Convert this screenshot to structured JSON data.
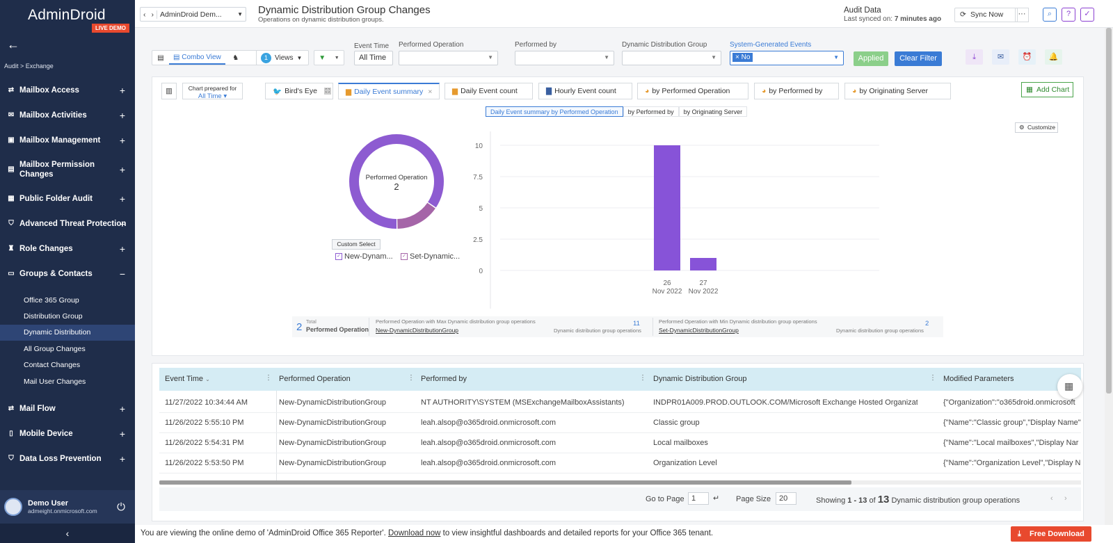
{
  "app": {
    "logo": "AdminDroid",
    "badge": "LIVE DEMO"
  },
  "sidebar": {
    "breadcrumb": "Audit > Exchange",
    "items": [
      {
        "label": "Mailbox Access",
        "toggle": "+"
      },
      {
        "label": "Mailbox Activities",
        "toggle": "+"
      },
      {
        "label": "Mailbox Management",
        "toggle": "+"
      },
      {
        "label": "Mailbox Permission",
        "label2": "Changes",
        "toggle": "+"
      },
      {
        "label": "Public Folder Audit",
        "toggle": "+"
      },
      {
        "label": "Advanced Threat Protection",
        "toggle": "+"
      },
      {
        "label": "Role Changes",
        "toggle": "+"
      },
      {
        "label": "Groups & Contacts",
        "toggle": "−"
      },
      {
        "label": "Mail Flow",
        "toggle": "+"
      },
      {
        "label": "Mobile Device",
        "toggle": "+"
      },
      {
        "label": "Data Loss Prevention",
        "toggle": "+"
      }
    ],
    "subitems": [
      "Office 365 Group",
      "Distribution Group",
      "Dynamic Distribution",
      "All Group Changes",
      "Contact Changes",
      "Mail User Changes"
    ],
    "user": {
      "name": "Demo User",
      "email": "admeight.onmicrosoft.com"
    }
  },
  "header": {
    "nav_select": "AdminDroid Dem...",
    "title": "Dynamic Distribution Group Changes",
    "subtitle": "Operations on dynamic distribution groups.",
    "audit_label": "Audit Data",
    "synced_prefix": "Last synced on:",
    "synced_value": "7 minutes ago",
    "sync_button": "Sync Now",
    "more": "···"
  },
  "filters": {
    "combo_view": "Combo View",
    "views_count": "1",
    "views_label": "Views",
    "event_time_label": "Event Time",
    "event_time_value": "All Time",
    "performed_operation_label": "Performed Operation",
    "performed_by_label": "Performed by",
    "ddg_label": "Dynamic Distribution Group",
    "system_events_label": "System-Generated Events",
    "system_events_value": "× No",
    "applied_button": "Applied",
    "clear_button": "Clear Filter"
  },
  "chart_tabs": {
    "prepared_label": "Chart prepared for",
    "prepared_value": "All Time",
    "tabs": [
      "Bird's Eye",
      "Daily Event summary",
      "Daily Event count",
      "Hourly Event count",
      "by Performed Operation",
      "by Performed by",
      "by Originating Server"
    ],
    "add_chart": "Add Chart",
    "subtabs": [
      "Daily Event summary by Performed Operation",
      "by Performed by",
      "by Originating Server"
    ],
    "customize": "Customize",
    "custom_select": "Custom Select"
  },
  "donut": {
    "center_label": "Performed Operation",
    "center_value": "2",
    "legend": [
      "New-Dynam...",
      "Set-Dynamic..."
    ]
  },
  "chart_data": {
    "type": "bar",
    "categories": [
      "26 Nov 2022",
      "27 Nov 2022"
    ],
    "values": [
      10,
      1
    ],
    "ylim": [
      0,
      10
    ],
    "yticks": [
      "0",
      "2.5",
      "5",
      "7.5",
      "10"
    ],
    "xticks": [
      {
        "d": "26",
        "m": "Nov 2022"
      },
      {
        "d": "27",
        "m": "Nov 2022"
      }
    ],
    "pie": {
      "slices": [
        11,
        2
      ],
      "colors": [
        "#8d5bd1",
        "#a565a8"
      ]
    },
    "colors": {
      "bar": "#8753d8"
    }
  },
  "summary": {
    "total": "2",
    "total_small": "Total",
    "total_label": "Performed Operation",
    "max_label": "Performed Operation with Max Dynamic distribution group operations",
    "max_value": "11",
    "max_name": "New-DynamicDistributionGroup",
    "max_unit": "Dynamic distribution group operations",
    "min_label": "Performed Operation with Min Dynamic distribution group operations",
    "min_value": "2",
    "min_name": "Set-DynamicDistributionGroup",
    "min_unit": "Dynamic distribution group operations"
  },
  "table": {
    "columns": [
      "Event Time",
      "Performed Operation",
      "Performed by",
      "Dynamic Distribution Group",
      "Modified Parameters"
    ],
    "rows": [
      [
        "11/27/2022 10:34:44 AM",
        "New-DynamicDistributionGroup",
        "NT AUTHORITY\\SYSTEM (MSExchangeMailboxAssistants)",
        "INDPR01A009.PROD.OUTLOOK.COM/Microsoft Exchange Hosted Organizati...",
        "{\"Organization\":\"o365droid.onmicrosoft"
      ],
      [
        "11/26/2022 5:55:10 PM",
        "New-DynamicDistributionGroup",
        "leah.alsop@o365droid.onmicrosoft.com",
        "Classic group",
        "{\"Name\":\"Classic group\",\"Display Name\""
      ],
      [
        "11/26/2022 5:54:31 PM",
        "New-DynamicDistributionGroup",
        "leah.alsop@o365droid.onmicrosoft.com",
        "Local mailboxes",
        "{\"Name\":\"Local mailboxes\",\"Display Nar"
      ],
      [
        "11/26/2022 5:53:50 PM",
        "New-DynamicDistributionGroup",
        "leah.alsop@o365droid.onmicrosoft.com",
        "Organization Level",
        "{\"Name\":\"Organization Level\",\"Display N"
      ]
    ],
    "goto_label": "Go to Page",
    "goto_value": "1",
    "page_size_label": "Page Size",
    "page_size_value": "20",
    "showing_prefix": "Showing",
    "showing_range": "1 - 13",
    "showing_of": "of",
    "showing_total": "13",
    "showing_suffix": "Dynamic distribution group operations"
  },
  "footer": {
    "text1": "You are viewing the online demo of 'AdminDroid Office 365 Reporter'.",
    "link": "Download now",
    "text2": "to view insightful dashboards and detailed reports for your Office 365 tenant.",
    "free_download": "Free Download"
  }
}
